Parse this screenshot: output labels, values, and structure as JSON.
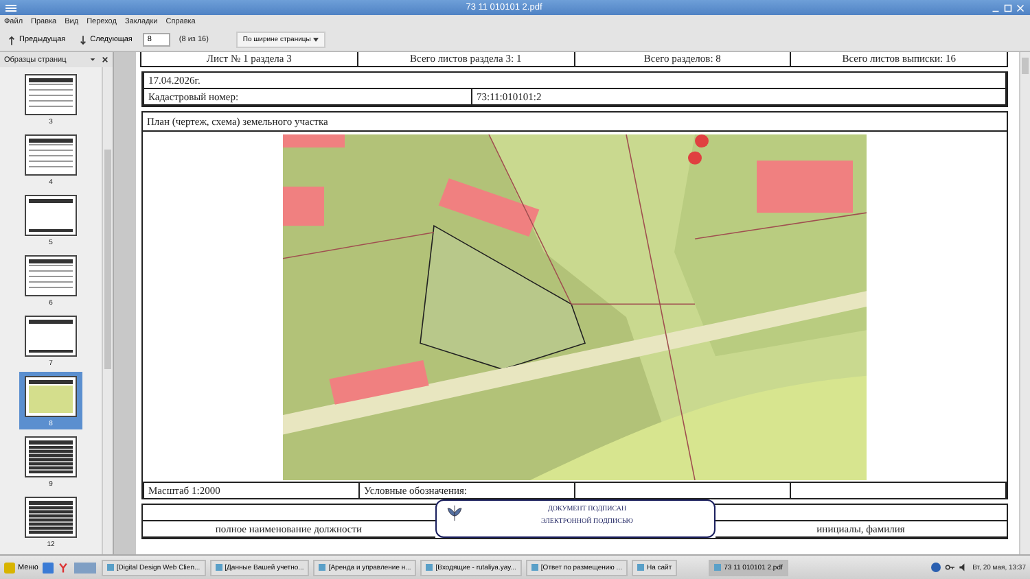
{
  "window": {
    "title": "73 11 010101 2.pdf"
  },
  "menu": [
    "Файл",
    "Правка",
    "Вид",
    "Переход",
    "Закладки",
    "Справка"
  ],
  "toolbar": {
    "prev": "Предыдущая",
    "next": "Следующая",
    "page_value": "8",
    "page_count": "(8 из 16)",
    "zoom": "По ширине страницы"
  },
  "sidebar": {
    "title": "Образцы страниц",
    "thumbnails": [
      {
        "label": "3",
        "kind": "table",
        "selected": false
      },
      {
        "label": "4",
        "kind": "table",
        "selected": false
      },
      {
        "label": "5",
        "kind": "blank",
        "selected": false
      },
      {
        "label": "6",
        "kind": "table",
        "selected": false
      },
      {
        "label": "7",
        "kind": "blank",
        "selected": false
      },
      {
        "label": "8",
        "kind": "map",
        "selected": true
      },
      {
        "label": "9",
        "kind": "grid",
        "selected": false
      },
      {
        "label": "12",
        "kind": "grid",
        "selected": false
      }
    ]
  },
  "document": {
    "header": [
      "Лист № 1 раздела 3",
      "Всего листов раздела 3: 1",
      "Всего разделов: 8",
      "Всего листов выписки: 16"
    ],
    "date": "17.04.2026г.",
    "cadastral_label": "Кадастровый номер:",
    "cadastral_value": "73:11:010101:2",
    "plan_title": "План (чертеж, схема) земельного участка",
    "scale": "Масштаб 1:2000",
    "legend": "Условные обозначения:",
    "position_label": "полное наименование должности",
    "name_label": "инициалы, фамилия",
    "stamp": [
      "ДОКУМЕНТ ПОДПИСАН",
      "ЭЛЕКТРОННОЙ ПОДПИСЬЮ"
    ]
  },
  "taskbar": {
    "start": "Меню",
    "windows": [
      {
        "label": "[Digital Design Web Clien...",
        "selected": false
      },
      {
        "label": "[Данные Вашей учетно...",
        "selected": false
      },
      {
        "label": "[Аренда и управление н...",
        "selected": false
      },
      {
        "label": "[Входящие - rutaliya.yay...",
        "selected": false
      },
      {
        "label": "[Ответ по размещению ...",
        "selected": false
      },
      {
        "label": "На сайт",
        "selected": false
      },
      {
        "label": "73 11 010101 2.pdf",
        "selected": true
      }
    ],
    "clock": "Вт, 20 мая, 13:37"
  }
}
